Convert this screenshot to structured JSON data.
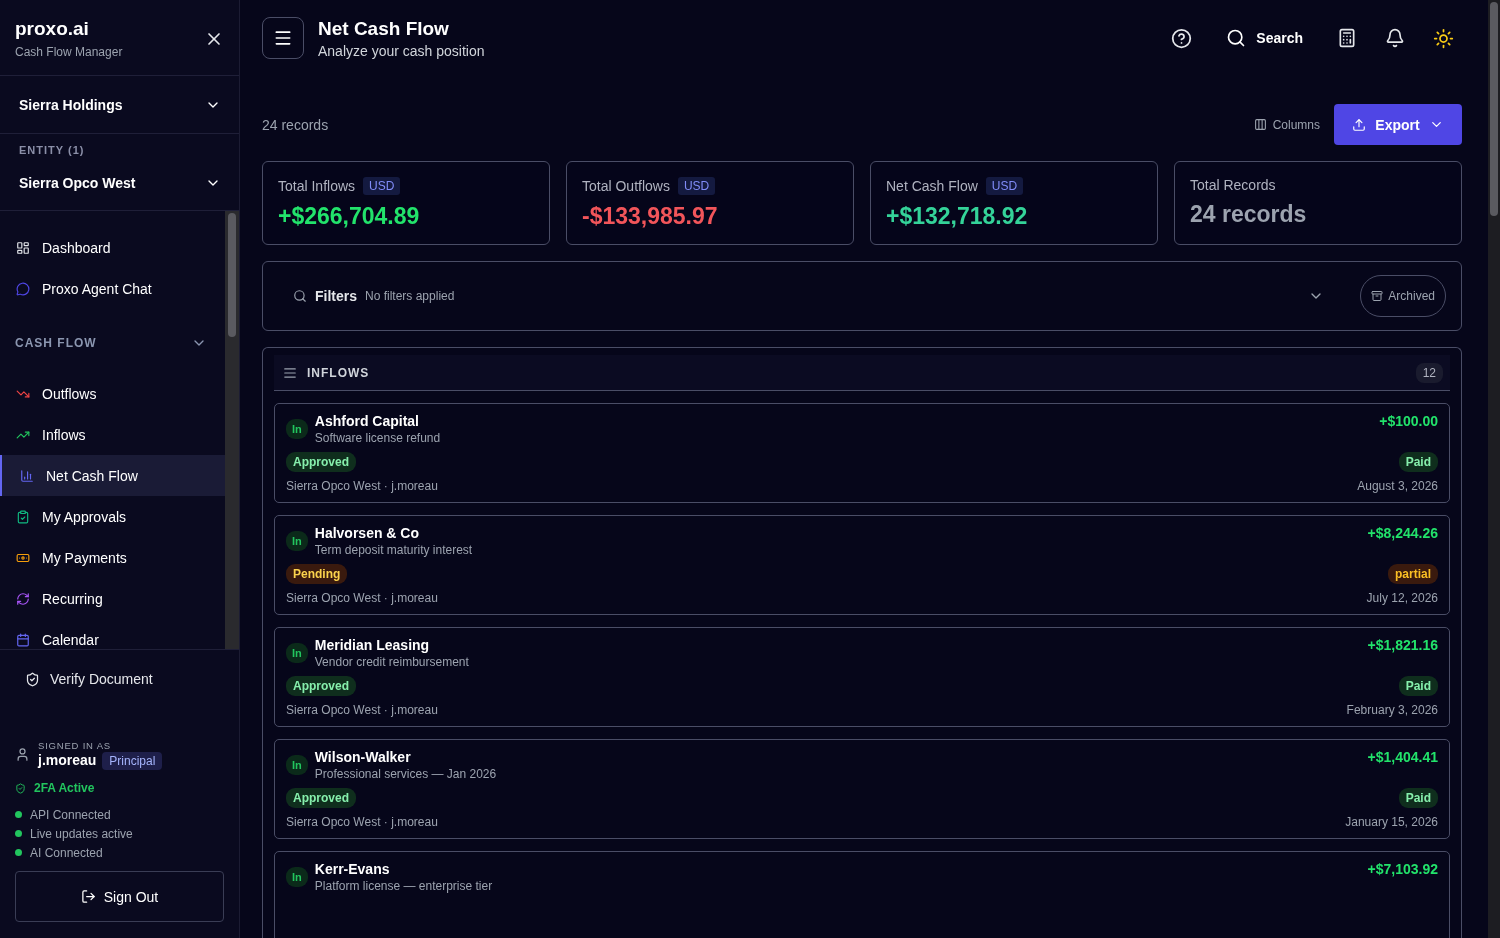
{
  "brand": {
    "name": "proxo.ai",
    "tagline": "Cash Flow Manager"
  },
  "org_select": {
    "value": "Sierra Holdings"
  },
  "entity": {
    "label": "ENTITY (1)",
    "value": "Sierra Opco West"
  },
  "nav": [
    {
      "label": "Dashboard",
      "selected": false
    },
    {
      "label": "Proxo Agent Chat",
      "selected": false
    }
  ],
  "cash_flow_section": {
    "title": "CASH FLOW",
    "expanded": true,
    "items": [
      {
        "label": "Outflows",
        "selected": false
      },
      {
        "label": "Inflows",
        "selected": false
      },
      {
        "label": "Net Cash Flow",
        "selected": true
      },
      {
        "label": "My Approvals",
        "selected": false
      },
      {
        "label": "My Payments",
        "selected": false
      },
      {
        "label": "Recurring",
        "selected": false
      },
      {
        "label": "Calendar",
        "selected": false
      }
    ]
  },
  "verify": {
    "label": "Verify Document"
  },
  "user": {
    "caption": "SIGNED IN AS",
    "name": "j.moreau",
    "role": "Principal",
    "twofa": "2FA Active"
  },
  "statuses": [
    {
      "label": "API Connected",
      "color": "#22c55e"
    },
    {
      "label": "Live updates active",
      "color": "#22c55e"
    },
    {
      "label": "AI Connected",
      "color": "#22c55e"
    }
  ],
  "sign_out": "Sign Out",
  "header": {
    "title": "Net Cash Flow",
    "subtitle": "Analyze your cash position",
    "search": "Search"
  },
  "toolbar": {
    "count": "24 records",
    "columns": "Columns",
    "export": "Export"
  },
  "stats": [
    {
      "label": "Total Inflows",
      "badge": "USD",
      "value": "+$266,704.89",
      "kind": "positive"
    },
    {
      "label": "Total Outflows",
      "badge": "USD",
      "value": "-$133,985.97",
      "kind": "negative"
    },
    {
      "label": "Net Cash Flow",
      "badge": "USD",
      "value": "+$132,718.92",
      "kind": "net"
    },
    {
      "label": "Total Records",
      "value": "24 records",
      "kind": "neutral"
    }
  ],
  "filters": {
    "label": "Filters",
    "summary": "No filters applied",
    "archived": "Archived"
  },
  "inflows": {
    "title": "INFLOWS",
    "count": "12",
    "items": [
      {
        "tag": "In",
        "name": "Ashford Capital",
        "description": "Software license refund",
        "amount": "+$100.00",
        "status": {
          "label": "Approved",
          "kind": "approved"
        },
        "payment": {
          "label": "Paid",
          "kind": "paid"
        },
        "meta": "Sierra Opco West · j.moreau",
        "date": "August 3, 2026"
      },
      {
        "tag": "In",
        "name": "Halvorsen & Co",
        "description": "Term deposit maturity interest",
        "amount": "+$8,244.26",
        "status": {
          "label": "Pending",
          "kind": "pending"
        },
        "payment": {
          "label": "partial",
          "kind": "partial"
        },
        "meta": "Sierra Opco West · j.moreau",
        "date": "July 12, 2026"
      },
      {
        "tag": "In",
        "name": "Meridian Leasing",
        "description": "Vendor credit reimbursement",
        "amount": "+$1,821.16",
        "status": {
          "label": "Approved",
          "kind": "approved"
        },
        "payment": {
          "label": "Paid",
          "kind": "paid"
        },
        "meta": "Sierra Opco West · j.moreau",
        "date": "February 3, 2026"
      },
      {
        "tag": "In",
        "name": "Wilson-Walker",
        "description": "Professional services — Jan 2026",
        "amount": "+$1,404.41",
        "status": {
          "label": "Approved",
          "kind": "approved"
        },
        "payment": {
          "label": "Paid",
          "kind": "paid"
        },
        "meta": "Sierra Opco West · j.moreau",
        "date": "January 15, 2026"
      },
      {
        "tag": "In",
        "name": "Kerr-Evans",
        "description": "Platform license — enterprise tier",
        "amount": "+$7,103.92"
      }
    ]
  }
}
